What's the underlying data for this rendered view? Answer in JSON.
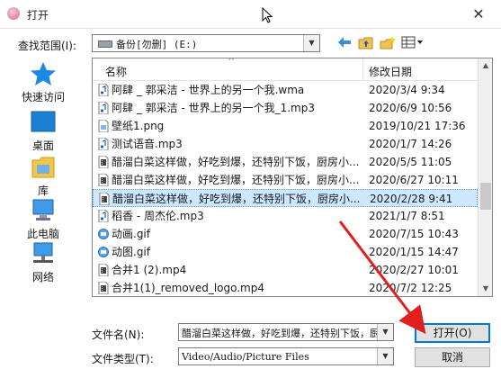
{
  "window": {
    "title": "打开",
    "close_glyph": "✕",
    "icon": "app-icon",
    "accent": "#0078d7",
    "annotation_color": "#e02020"
  },
  "lookin": {
    "label": "查找范围(I):",
    "value": "备份[勿删] (E:)",
    "icon": "drive-icon"
  },
  "toolbar": {
    "back": "back-arrow-icon",
    "up": "up-folder-icon",
    "new_folder": "new-folder-icon",
    "view_menu": "view-menu-icon"
  },
  "nav": [
    {
      "label": "快速访问",
      "icon": "star-icon"
    },
    {
      "label": "桌面",
      "icon": "desktop-icon"
    },
    {
      "label": "库",
      "icon": "library-icon"
    },
    {
      "label": "此电脑",
      "icon": "computer-icon"
    },
    {
      "label": "网络",
      "icon": "network-icon"
    }
  ],
  "list": {
    "columns": {
      "name": "名称",
      "date": "修改日期"
    },
    "rows": [
      {
        "name": "阿肆 _ 郭采洁 - 世界上的另一个我.wma",
        "date": "2020/3/4 9:34",
        "icon": "audio-file-icon"
      },
      {
        "name": "阿肆 _ 郭采洁 - 世界上的另一个我_1.mp3",
        "date": "2020/6/9 10:56",
        "icon": "audio-file-icon"
      },
      {
        "name": "壁纸1.png",
        "date": "2019/10/21 17:36",
        "icon": "image-file-icon"
      },
      {
        "name": "测试语音.mp3",
        "date": "2020/1/7 14:26",
        "icon": "audio-file-icon"
      },
      {
        "name": "醋溜白菜这样做，好吃到爆，还特别下饭，厨房小...",
        "date": "2020/5/5 11:05",
        "icon": "video-file-icon"
      },
      {
        "name": "醋溜白菜这样做，好吃到爆，还特别下饭，厨房小...",
        "date": "2020/6/27 10:11",
        "icon": "video-file-icon"
      },
      {
        "name": "醋溜白菜这样做，好吃到爆，还特别下饭，厨房小...",
        "date": "2020/2/28 9:41",
        "icon": "video-file-icon",
        "selected": true
      },
      {
        "name": "稻香 - 周杰伦.mp3",
        "date": "2021/1/7 8:51",
        "icon": "audio-file-icon"
      },
      {
        "name": "动画.gif",
        "date": "2020/7/15 10:43",
        "icon": "gif-file-icon"
      },
      {
        "name": "动图.gif",
        "date": "2020/1/15 14:47",
        "icon": "gif-file-icon"
      },
      {
        "name": "合并1 (2).mp4",
        "date": "2020/2/27 10:01",
        "icon": "video-file-icon"
      },
      {
        "name": "合并1(1)_removed_logo.mp4",
        "date": "2020/7/2 12:25",
        "icon": "video-file-icon"
      }
    ]
  },
  "filename": {
    "label": "文件名(N):",
    "value": "醋溜白菜这样做，好吃到爆，还特别下饭，厨房小白"
  },
  "filetype": {
    "label": "文件类型(T):",
    "value": "Video/Audio/Picture Files"
  },
  "buttons": {
    "open": "打开(O)",
    "cancel": "取消"
  }
}
